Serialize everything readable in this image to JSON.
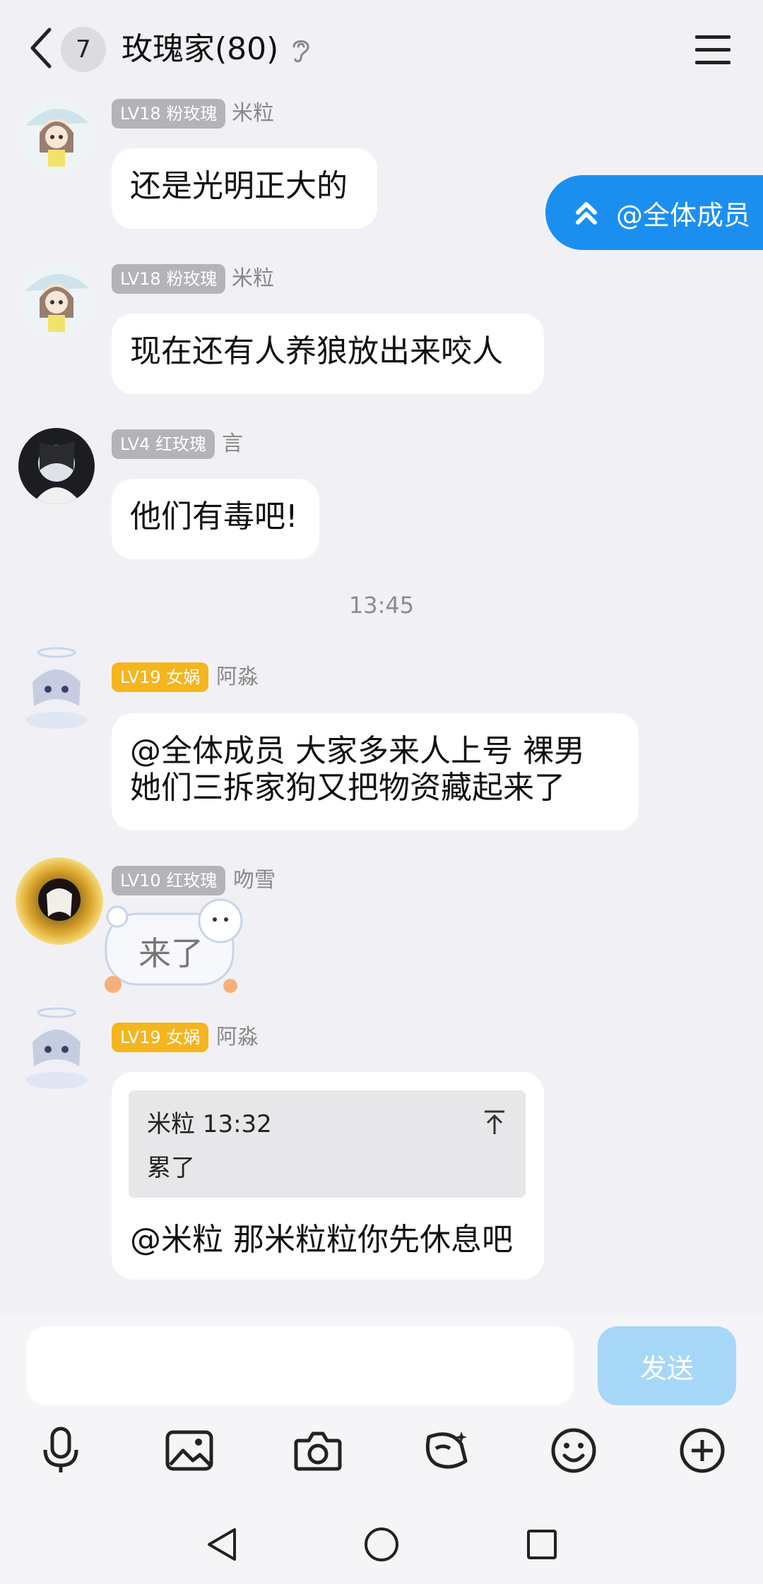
{
  "header": {
    "unread_count": "7",
    "title": "玫瑰家(80)"
  },
  "floating": {
    "at_all_label": "@全体成员"
  },
  "messages": [
    {
      "badge": "LV18 粉玫瑰",
      "badge_color": "#b3b3b8",
      "nickname": "米粒",
      "text": "还是光明正大的"
    },
    {
      "badge": "LV18 粉玫瑰",
      "badge_color": "#b3b3b8",
      "nickname": "米粒",
      "text": "现在还有人养狼放出来咬人"
    },
    {
      "badge": "LV4 红玫瑰",
      "badge_color": "#b3b3b8",
      "nickname": "言",
      "text": "他们有毒吧!"
    },
    {
      "badge": "LV19 女娲",
      "badge_color": "#f5b51e",
      "nickname": "阿淼",
      "text_line1": "@全体成员 大家多来人上号 裸男",
      "text_line2": "她们三拆家狗又把物资藏起来了"
    },
    {
      "badge": "LV10 红玫瑰",
      "badge_color": "#b3b3b8",
      "nickname": "吻雪",
      "sticker_text": "来了"
    },
    {
      "badge": "LV19 女娲",
      "badge_color": "#f5b51e",
      "nickname": "阿淼",
      "quote_meta": "米粒 13:32",
      "quote_text": "累了",
      "text": "@米粒 那米粒粒你先休息吧"
    }
  ],
  "timestamp": "13:45",
  "input": {
    "value": "",
    "send_label": "发送"
  },
  "toolbar": [
    "microphone-icon",
    "image-icon",
    "camera-icon",
    "red-packet-icon",
    "emoji-icon",
    "plus-icon"
  ],
  "colors": {
    "accent": "#1b8ff0",
    "send_disabled": "#a7d7f7",
    "background": "#f1f1f5"
  }
}
